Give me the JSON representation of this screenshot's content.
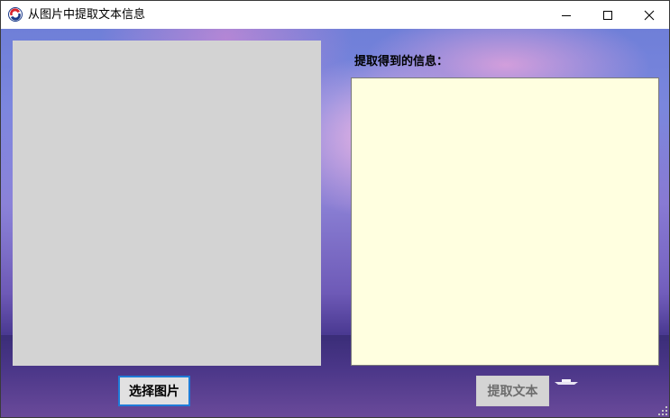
{
  "window": {
    "title": "从图片中提取文本信息",
    "app_icon": "app-logo-icon",
    "controls": {
      "minimize_icon": "minimize-icon",
      "maximize_icon": "maximize-icon",
      "close_icon": "close-icon"
    }
  },
  "main": {
    "info_label": "提取得到的信息：",
    "info_text": "",
    "choose_button_label": "选择图片",
    "extract_button_label": "提取文本"
  },
  "colors": {
    "image_panel_bg": "#d3d3d3",
    "text_area_bg": "#ffffe0",
    "focus_border": "#1f7bd8",
    "disabled_text": "#6d6d6d"
  }
}
